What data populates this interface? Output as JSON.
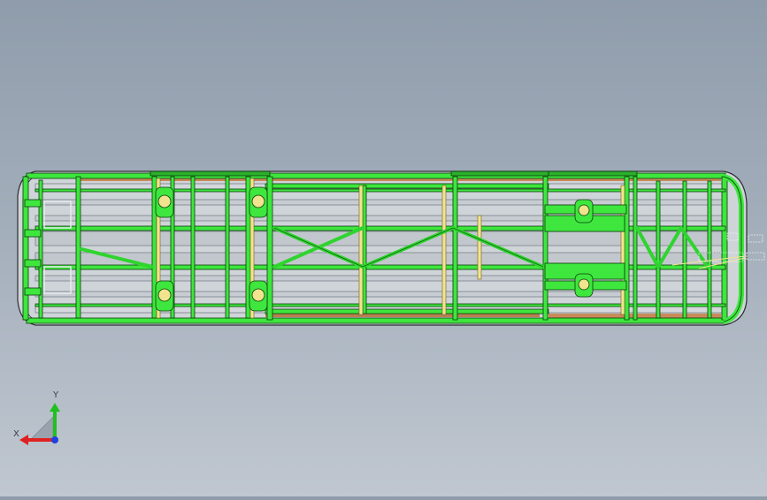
{
  "window": {
    "view": "cad-graphics-area",
    "background_top": "#8f9cab",
    "background_bottom": "#c0c7d0"
  },
  "model": {
    "name": "bus-chassis-frame",
    "frame_color": "#3ee63e",
    "frame_edge_color": "#0b3d0b",
    "rail_color": "#c7ccd2",
    "brace_color": "#f2e38e",
    "floor_color": "#c98a5a",
    "icons": [
      "wheel-hub-icon",
      "front-annotation-icon"
    ]
  },
  "triad": {
    "x_label": "X",
    "y_label": "Y",
    "x_color": "#e02020",
    "y_color": "#20c020",
    "z_color": "#2040e0"
  }
}
